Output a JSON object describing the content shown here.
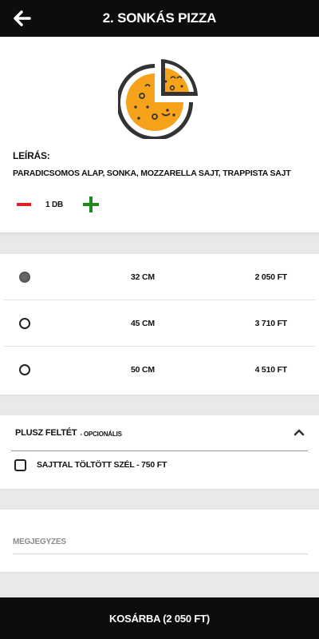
{
  "header": {
    "title": "2. Sonkás pizza",
    "back_icon": "arrow-left-icon"
  },
  "product": {
    "icon": "pizza-icon",
    "icon_colors": {
      "fill": "#F7A21B",
      "stroke": "#333333"
    },
    "description_label": "Leírás:",
    "description": "Paradicsomos alap, sonka, mozzarella sajt, trappista sajt",
    "quantity": "1 db",
    "minus_color": "#E02020",
    "plus_color": "#1E8A1E"
  },
  "sizes": [
    {
      "label": "32 cm",
      "price": "2 050 Ft",
      "selected": true
    },
    {
      "label": "45 cm",
      "price": "3 710 Ft",
      "selected": false
    },
    {
      "label": "50 cm",
      "price": "4 510 Ft",
      "selected": false
    }
  ],
  "extras": {
    "title": "Plusz feltét",
    "optional_label": "- opcionális",
    "expanded": true,
    "items": [
      {
        "label": "Sajttal töltött szél - 750 Ft",
        "checked": false
      }
    ]
  },
  "note": {
    "placeholder": "Megjegyzés",
    "value": ""
  },
  "footer": {
    "cart_label": "Kosárba (2 050 Ft)"
  }
}
